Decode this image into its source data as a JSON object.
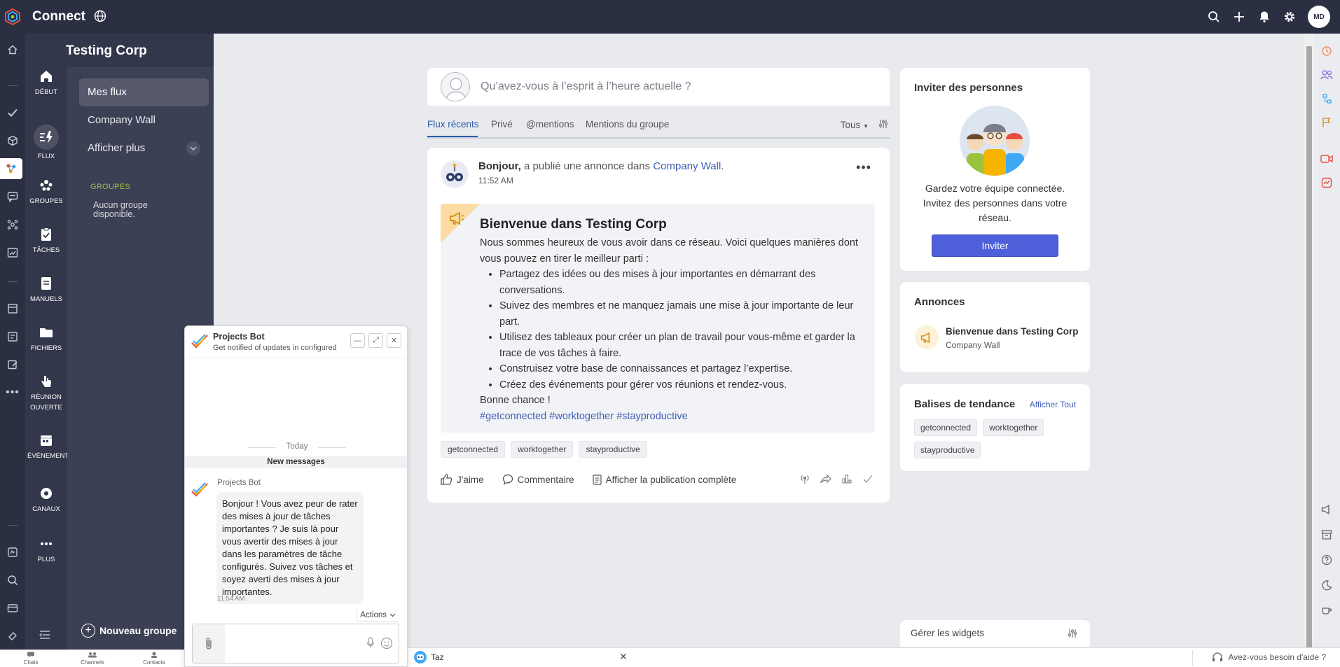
{
  "app": {
    "brand": "Connect",
    "avatar_initials": "MD"
  },
  "colors": {
    "topbar": "#2b2f42",
    "accent": "#4d5fd9",
    "link": "#3f5fb5",
    "groups_label": "#9bc43c"
  },
  "nav": {
    "items": [
      {
        "label": "DÉBUT",
        "icon": "home-icon"
      },
      {
        "label": "FLUX",
        "icon": "flux-icon",
        "active": true
      },
      {
        "label": "GROUPES",
        "icon": "groups-icon"
      },
      {
        "label": "TÂCHES",
        "icon": "tasks-icon"
      },
      {
        "label": "MANUELS",
        "icon": "manuals-icon"
      },
      {
        "label": "FICHIERS",
        "icon": "folder-icon"
      },
      {
        "label": "RÉUNION OUVERTE",
        "icon": "hand-icon"
      },
      {
        "label": "ÉVÉNEMENTS",
        "icon": "calendar-icon"
      },
      {
        "label": "CANAUX",
        "icon": "channels-icon"
      },
      {
        "label": "PLUS",
        "icon": "more-icon"
      }
    ]
  },
  "sidebar": {
    "org": "Testing Corp",
    "items": [
      {
        "label": "Mes flux"
      },
      {
        "label": "Company Wall"
      },
      {
        "label": "Afficher plus"
      }
    ],
    "groups_heading": "GROUPES",
    "groups_empty": "Aucun groupe disponible.",
    "new_group": "Nouveau groupe"
  },
  "bottom_bar": {
    "chats": "Chats",
    "channels": "Channels",
    "contacts": "Contacts"
  },
  "composer": {
    "placeholder": "Qu’avez-vous à l’esprit à l’heure actuelle ?"
  },
  "tabs": {
    "items": [
      "Flux récents",
      "Privé",
      "@mentions",
      "Mentions du groupe"
    ],
    "filter": "Tous"
  },
  "post": {
    "author": "Bonjour,",
    "action": " a publié une annonce dans ",
    "target": "Company Wall",
    "period": ".",
    "time": "11:52 AM",
    "title": "Bienvenue dans Testing Corp",
    "intro": "Nous sommes heureux de vous avoir dans ce réseau. Voici quelques manières dont vous pouvez en tirer le meilleur parti :",
    "bullets": [
      "Partagez des idées ou des mises à jour importantes en démarrant des conversations.",
      "Suivez des membres et ne manquez jamais une mise à jour importante de leur part.",
      "Utilisez des tableaux pour créer un plan de travail pour vous-même et garder la trace de vos tâches à faire.",
      "Construisez votre base de connaissances et partagez l’expertise.",
      "Créez des événements pour gérer vos réunions et rendez-vous."
    ],
    "closing": "Bonne chance !",
    "hashtags": "#getconnected #worktogether #stayproductive",
    "chips": [
      "getconnected",
      "worktogether",
      "stayproductive"
    ],
    "like": "J'aime",
    "comment": "Commentaire",
    "view_full": "Afficher la publication complète"
  },
  "invite_card": {
    "title": "Inviter des personnes",
    "text": "Gardez votre équipe connectée. Invitez des personnes dans votre réseau.",
    "button": "Inviter"
  },
  "announcements_card": {
    "title": "Annonces",
    "item_title": "Bienvenue dans Testing Corp",
    "item_sub": "Company Wall"
  },
  "trending_card": {
    "title": "Balises de tendance",
    "view_all": "Afficher Tout",
    "tags": [
      "getconnected",
      "worktogether",
      "stayproductive"
    ]
  },
  "manage_widgets": "Gérer les widgets",
  "chat": {
    "name": "Projects Bot",
    "subtitle": "Get notified of updates in configured",
    "today": "Today",
    "new_messages": "New messages",
    "sender": "Projects Bot",
    "message": "Bonjour ! Vous avez peur de rater des mises à jour de tâches importantes ?  Je suis là pour vous avertir des mises à jour dans les paramètres de tâche configurés. Suivez vos tâches et soyez averti des mises à jour importantes.",
    "time": "11:54 AM",
    "actions": "Actions"
  },
  "status_bar": {
    "taz": "Taz",
    "help": "Avez-vous besoin d'aide ?"
  }
}
